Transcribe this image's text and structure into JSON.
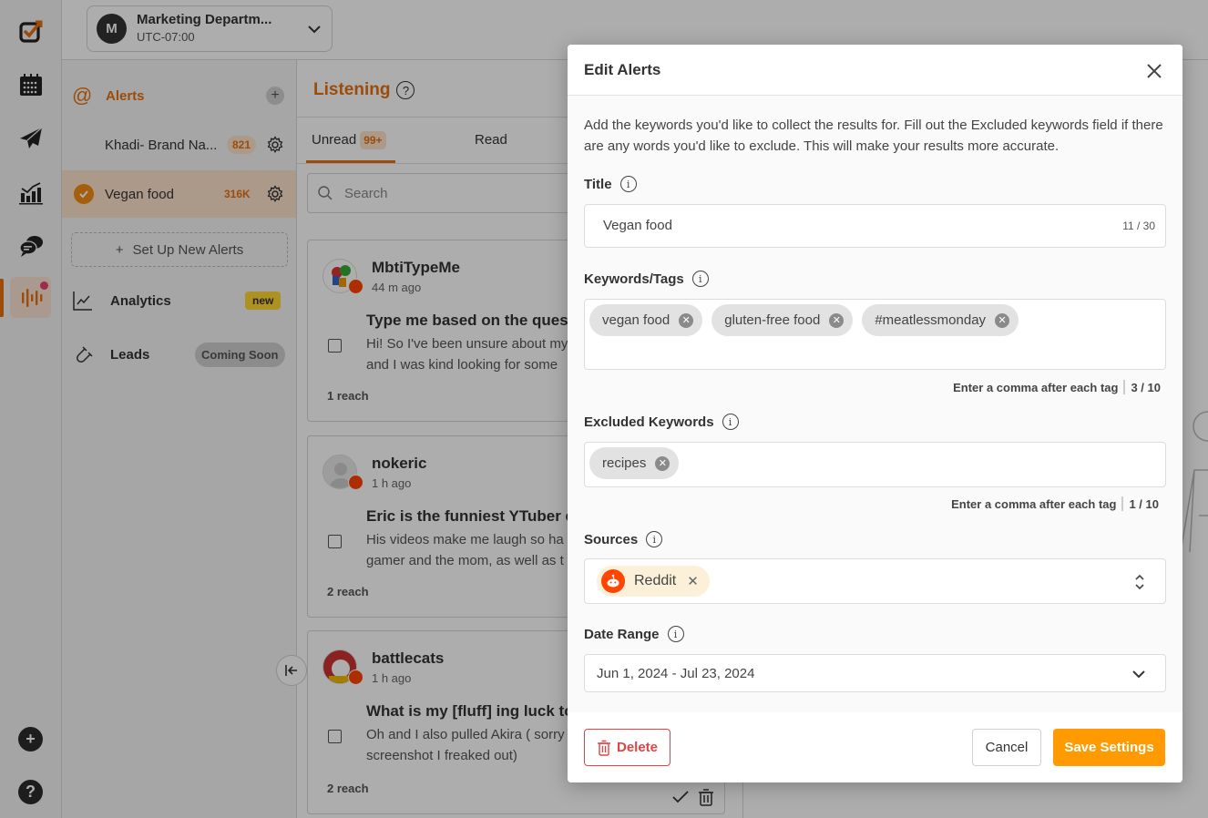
{
  "workspace": {
    "avatar_letter": "M",
    "name": "Marketing Departm...",
    "timezone": "UTC-07:00"
  },
  "rail": {
    "icons": [
      "logo-icon",
      "calendar-icon",
      "publish-icon",
      "analytics-icon",
      "inbox-icon",
      "listening-icon"
    ],
    "bottom": [
      "add-icon",
      "help-icon"
    ],
    "accent": "#e6700e"
  },
  "sidebar": {
    "alerts_label": "Alerts",
    "alerts": [
      {
        "title": "Khadi- Brand Na...",
        "count": "821",
        "selected": false
      },
      {
        "title": "Vegan food",
        "count": "316K",
        "selected": true
      }
    ],
    "new_alert_label": "Set Up New Alerts",
    "nav": [
      {
        "label": "Analytics",
        "badge": "new"
      },
      {
        "label": "Leads",
        "badge": "Coming Soon"
      }
    ]
  },
  "feed": {
    "title": "Listening",
    "tabs": [
      {
        "label": "Unread",
        "badge": "99+",
        "active": true
      },
      {
        "label": "Read",
        "active": false
      }
    ],
    "search_placeholder": "Search",
    "posts": [
      {
        "user": "MbtiTypeMe",
        "time": "44 m ago",
        "title": "Type me based on the ques",
        "body_line1": "Hi! So I've been unsure about my",
        "body_line2": "and I was kind looking for some",
        "reach": "1 reach"
      },
      {
        "user": "nokeric",
        "time": "1 h ago",
        "title": "Eric is the funniest YTuber e",
        "body_line1": "His videos make me laugh so ha",
        "body_line2": "gamer and the mom, as well as t",
        "reach": "2 reach"
      },
      {
        "user": "battlecats",
        "time": "1 h ago",
        "title": "What is my [fluff] ing luck to",
        "body_line1": "Oh and I also pulled Akira ( sorry",
        "body_line2": "screenshot I freaked out)",
        "reach": "2 reach"
      }
    ]
  },
  "modal": {
    "title": "Edit Alerts",
    "description": "Add the keywords you'd like to collect the results for. Fill out the Excluded keywords field if there are any words you'd like to exclude. This will make your results more accurate.",
    "title_field": {
      "label": "Title",
      "value": "Vegan food",
      "counter": "11 / 30"
    },
    "keywords": {
      "label": "Keywords/Tags",
      "tags": [
        "vegan food",
        "gluten-free food",
        "#meatlessmonday"
      ],
      "hint": "Enter a comma after each tag",
      "count": "3 / 10"
    },
    "excluded": {
      "label": "Excluded Keywords",
      "tags": [
        "recipes"
      ],
      "hint": "Enter a comma after each tag",
      "count": "1 / 10"
    },
    "sources": {
      "label": "Sources",
      "selected": [
        "Reddit"
      ]
    },
    "date_range": {
      "label": "Date Range",
      "value": "Jun 1, 2024 - Jul 23, 2024"
    },
    "buttons": {
      "delete": "Delete",
      "cancel": "Cancel",
      "save": "Save Settings"
    },
    "colors": {
      "save": "#ff9a00",
      "delete": "#e04545",
      "reddit": "#ff4500"
    }
  }
}
